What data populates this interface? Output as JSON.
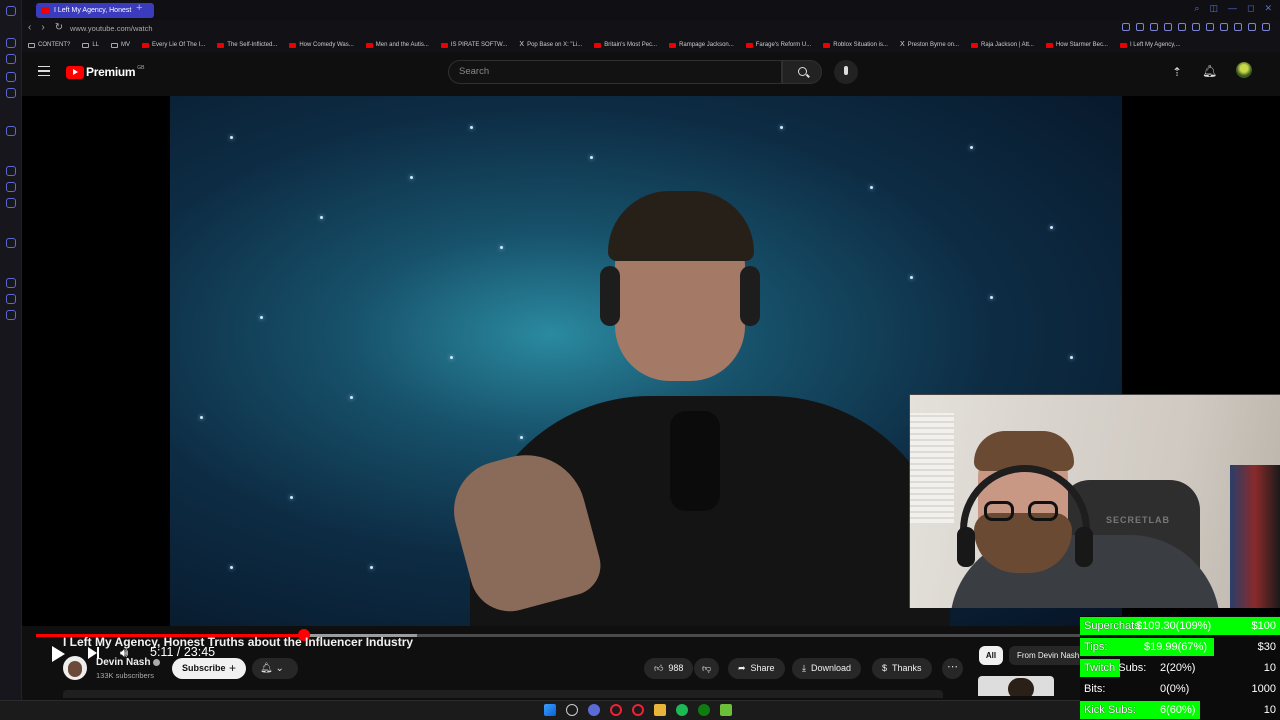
{
  "browser": {
    "tab_title": "I Left My Agency, Honest",
    "url": "www.youtube.com/watch",
    "bookmarks": [
      {
        "label": "CONTENT?",
        "icon": "folder-icon"
      },
      {
        "label": "LL",
        "icon": "folder-icon"
      },
      {
        "label": "MV",
        "icon": "folder-icon"
      },
      {
        "label": "Every Lie Of The I...",
        "icon": "youtube-icon"
      },
      {
        "label": "The Self-Inflicted...",
        "icon": "youtube-icon"
      },
      {
        "label": "How Comedy Was...",
        "icon": "youtube-icon"
      },
      {
        "label": "Men and the Autis...",
        "icon": "youtube-icon"
      },
      {
        "label": "IS PIRATE SOFTW...",
        "icon": "youtube-icon"
      },
      {
        "label": "Pop Base on X: \"Li...",
        "icon": "x-icon"
      },
      {
        "label": "Britain's Most Pec...",
        "icon": "youtube-icon"
      },
      {
        "label": "Rampage Jackson...",
        "icon": "youtube-icon"
      },
      {
        "label": "Farage's Reform U...",
        "icon": "youtube-icon"
      },
      {
        "label": "Roblox Situation is...",
        "icon": "youtube-icon"
      },
      {
        "label": "Preston Byrne on...",
        "icon": "x-icon"
      },
      {
        "label": "Raja Jackson | Att...",
        "icon": "youtube-icon"
      },
      {
        "label": "How Starmer Bec...",
        "icon": "youtube-icon"
      },
      {
        "label": "I Left My Agency,...",
        "icon": "youtube-icon"
      }
    ]
  },
  "youtube": {
    "logo_text": "Premium",
    "logo_badge": "GB",
    "search_placeholder": "Search"
  },
  "player": {
    "current_time": "5:11",
    "duration": "23:45",
    "time_display": "5:11 / 23:45",
    "progress_fraction": 0.218,
    "buffered_fraction": 0.31
  },
  "video": {
    "title": "I Left My Agency, Honest Truths about the Influencer Industry",
    "channel_name": "Devin Nash",
    "subscribers": "133K subscribers",
    "subscribe_label": "Subscribe",
    "likes": "988",
    "share_label": "Share",
    "download_label": "Download",
    "thanks_label": "Thanks"
  },
  "recommendations": {
    "chips": [
      "All",
      "From Devin Nash"
    ]
  },
  "webcam": {
    "chair_brand": "SECRETLAB"
  },
  "stream_stats": [
    {
      "label": "Superchats:",
      "value": "$109.30(109%)",
      "goal": "$100",
      "fraction": 1.0
    },
    {
      "label": "Tips:",
      "value": "$19.99(67%)",
      "goal": "$30",
      "fraction": 0.67
    },
    {
      "label": "Twitch Subs:",
      "value": "2(20%)",
      "goal": "10",
      "fraction": 0.2
    },
    {
      "label": "Bits:",
      "value": "0(0%)",
      "goal": "1000",
      "fraction": 0.0
    },
    {
      "label": "Kick Subs:",
      "value": "6(60%)",
      "goal": "10",
      "fraction": 0.6
    }
  ],
  "colors": {
    "youtube_red": "#ff0000",
    "progress_red": "#ff0000",
    "stat_bar_green": "#00ff00",
    "tab_active": "#3b3bbd"
  }
}
